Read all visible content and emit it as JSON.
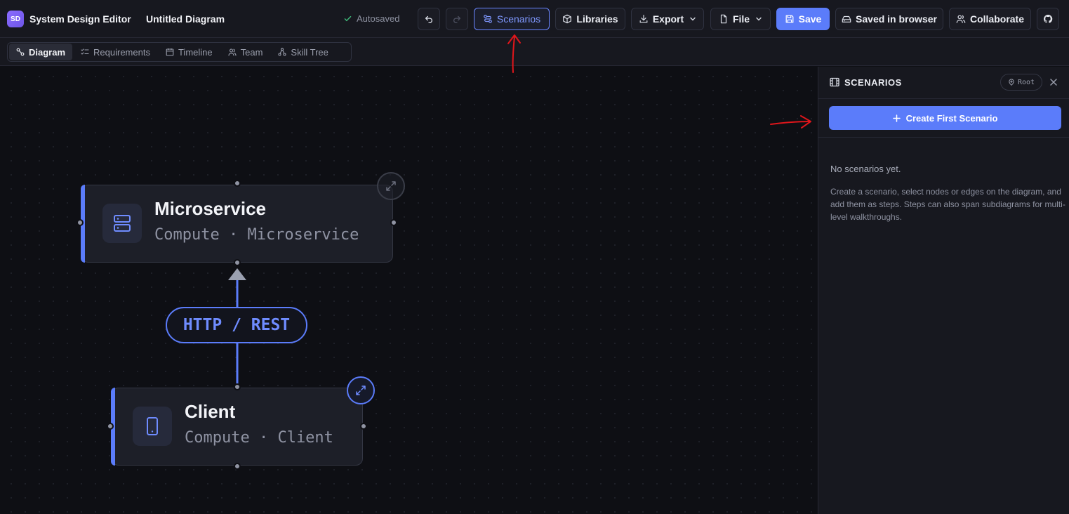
{
  "header": {
    "logo_text": "SD",
    "app_title": "System Design Editor",
    "doc_title": "Untitled Diagram",
    "autosave_status": "Autosaved",
    "buttons": {
      "scenarios": "Scenarios",
      "libraries": "Libraries",
      "export": "Export",
      "file": "File",
      "save": "Save",
      "saved_in_browser": "Saved in browser",
      "collaborate": "Collaborate"
    }
  },
  "tabs": [
    {
      "label": "Diagram",
      "active": true
    },
    {
      "label": "Requirements",
      "active": false
    },
    {
      "label": "Timeline",
      "active": false
    },
    {
      "label": "Team",
      "active": false
    },
    {
      "label": "Skill Tree",
      "active": false
    }
  ],
  "canvas": {
    "nodes": [
      {
        "title": "Microservice",
        "subtitle": "Compute · Microservice",
        "icon": "server-icon"
      },
      {
        "title": "Client",
        "subtitle": "Compute · Client",
        "icon": "tablet-icon"
      }
    ],
    "edge_label": "HTTP / REST"
  },
  "panel": {
    "title": "SCENARIOS",
    "badge": "Root",
    "create_button": "Create First Scenario",
    "empty_title": "No scenarios yet.",
    "empty_description": "Create a scenario, select nodes or edges on the diagram, and add them as steps. Steps can also span subdiagrams for multi-level walkthroughs."
  },
  "colors": {
    "accent": "#5b7cfa",
    "background": "#0e0f14",
    "surface": "#17181f",
    "annotation": "#e0161b",
    "success": "#3fb97a"
  }
}
